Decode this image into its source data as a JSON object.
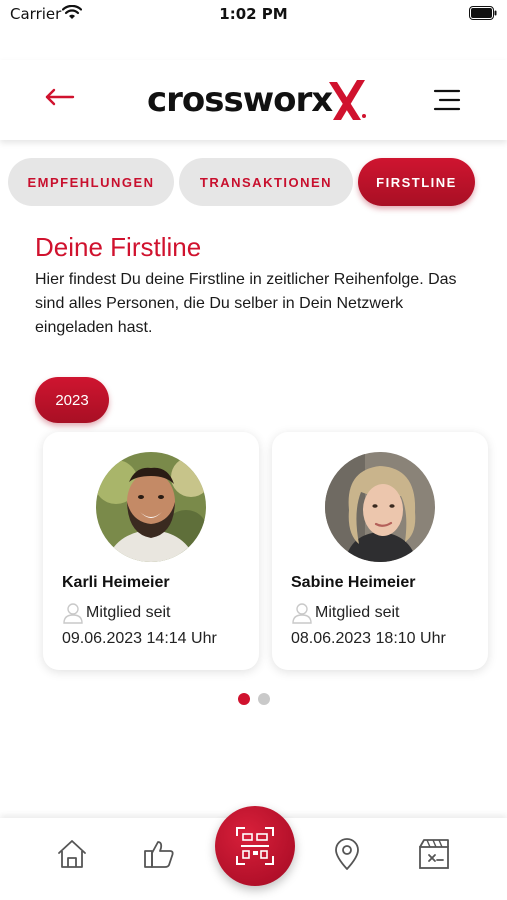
{
  "status_bar": {
    "carrier": "Carrier",
    "time": "1:02 PM"
  },
  "header": {
    "logo_text": "crossworx",
    "logo_letter": "X"
  },
  "tabs": [
    {
      "label": "EMPFEHLUNGEN",
      "active": false
    },
    {
      "label": "TRANSAKTIONEN",
      "active": false
    },
    {
      "label": "FIRSTLINE",
      "active": true
    }
  ],
  "section": {
    "title": "Deine Firstline",
    "description": "Hier findest Du deine Firstline in zeitlicher Reihenfolge. Das sind alles Personen, die Du selber in Dein Netzwerk eingeladen hast."
  },
  "year_badge": "2023",
  "members": [
    {
      "name": "Karli Heimeier",
      "member_label": "Mitglied seit",
      "date": "09.06.2023 14:14 Uhr"
    },
    {
      "name": "Sabine Heimeier",
      "member_label": "Mitglied seit",
      "date": "08.06.2023 18:10 Uhr"
    }
  ],
  "pagination": {
    "pages": 2,
    "current": 1
  },
  "colors": {
    "brand_red": "#d0122e",
    "tab_inactive_bg": "#e6e6e6",
    "dot_inactive": "#c9c9c9"
  },
  "bottom_nav": {
    "items": [
      {
        "icon": "home-icon"
      },
      {
        "icon": "thumbs-up-icon"
      },
      {
        "icon": "qr-scan-icon"
      },
      {
        "icon": "location-pin-icon"
      },
      {
        "icon": "ticket-icon"
      }
    ]
  }
}
